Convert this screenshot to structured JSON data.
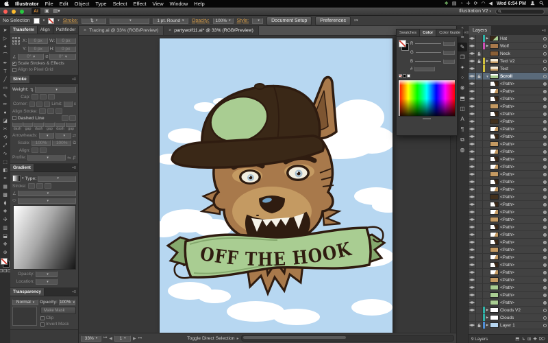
{
  "menubar": {
    "items": [
      "Illustrator",
      "File",
      "Edit",
      "Object",
      "Type",
      "Select",
      "Effect",
      "View",
      "Window",
      "Help"
    ],
    "status_icons": [
      {
        "n": "plugin-icon",
        "g": "❖",
        "c": "#7bc26a"
      },
      {
        "n": "display-icon",
        "g": "▤",
        "c": "#d8d8d8"
      },
      {
        "n": "clock-icon",
        "g": "◔",
        "c": "#d8d8d8"
      },
      {
        "n": "plus-icon",
        "g": "✛",
        "c": "#d8d8d8"
      },
      {
        "n": "sync-icon",
        "g": "⟳",
        "c": "#d8d8d8"
      },
      {
        "n": "wifi-icon",
        "g": "◠",
        "c": "#d8d8d8"
      },
      {
        "n": "volume-icon",
        "g": "◀",
        "c": "#d8d8d8"
      }
    ],
    "clock": "Wed 6:54 PM"
  },
  "titlebar": {
    "logo": "Ai",
    "workspace": "Illustration V2"
  },
  "controlbar": {
    "no_selection": "No Selection",
    "stroke_label": "Stroke:",
    "brush_value": "1 pt. Round",
    "opacity_label": "Opacity:",
    "opacity_value": "100%",
    "style_label": "Style:",
    "document_setup": "Document Setup",
    "preferences": "Preferences"
  },
  "tabs": [
    {
      "label": "Tracing.ai @ 33% (RGB/Preview)",
      "active": false
    },
    {
      "label": "partywolf11.ai* @ 33% (RGB/Preview)",
      "active": true
    }
  ],
  "toolbox": [
    {
      "n": "selection-tool",
      "g": "➤"
    },
    {
      "n": "direct-selection-tool",
      "g": "▷"
    },
    {
      "n": "magic-wand-tool",
      "g": "✦"
    },
    {
      "n": "lasso-tool",
      "g": "⌒"
    },
    {
      "n": "pen-tool",
      "g": "✒"
    },
    {
      "n": "type-tool",
      "g": "T"
    },
    {
      "n": "line-tool",
      "g": "╱"
    },
    {
      "n": "rectangle-tool",
      "g": "▭"
    },
    {
      "n": "paintbrush-tool",
      "g": "✎"
    },
    {
      "n": "pencil-tool",
      "g": "✏"
    },
    {
      "n": "blob-brush-tool",
      "g": "●"
    },
    {
      "n": "eraser-tool",
      "g": "◪"
    },
    {
      "n": "scissors-tool",
      "g": "✂"
    },
    {
      "n": "rotate-tool",
      "g": "⟲"
    },
    {
      "n": "scale-tool",
      "g": "⤢"
    },
    {
      "n": "width-tool",
      "g": "∿"
    },
    {
      "n": "free-transform-tool",
      "g": "⬚"
    },
    {
      "n": "shape-builder-tool",
      "g": "◧"
    },
    {
      "n": "perspective-grid-tool",
      "g": "⌗"
    },
    {
      "n": "mesh-tool",
      "g": "▦"
    },
    {
      "n": "gradient-tool",
      "g": "▩"
    },
    {
      "n": "eyedropper-tool",
      "g": "⧫"
    },
    {
      "n": "blend-tool",
      "g": "❖"
    },
    {
      "n": "symbol-sprayer-tool",
      "g": "✣"
    },
    {
      "n": "graph-tool",
      "g": "▥"
    },
    {
      "n": "artboard-tool",
      "g": "⬓"
    },
    {
      "n": "hand-tool",
      "g": "✥"
    },
    {
      "n": "zoom-tool",
      "g": "⊕"
    }
  ],
  "panels": {
    "transform": {
      "tabs": [
        "Transform",
        "Align",
        "Pathfinder"
      ],
      "x_label": "X:",
      "y_label": "Y:",
      "w_label": "W:",
      "h_label": "H:",
      "x_value": "0 px",
      "y_value": "0 px",
      "w_value": "0 px",
      "h_value": "0 px",
      "rotate_value": "0°",
      "shear_value": "0°",
      "scale_strokes": "Scale Strokes & Effects",
      "align_pixel": "Align to Pixel Grid"
    },
    "stroke": {
      "title": "Stroke",
      "weight_label": "Weight:",
      "cap_label": "Cap:",
      "corner_label": "Corner:",
      "limit_label": "Limit:",
      "limit_x": "x",
      "align_stroke_label": "Align Stroke:",
      "dashed_label": "Dashed Line",
      "dash_labels": [
        "dash",
        "gap",
        "dash",
        "gap",
        "dash",
        "gap"
      ],
      "arrowheads_label": "Arrowheads:",
      "scale_label": "Scale:",
      "scale_v1": "100%",
      "scale_v2": "100%",
      "align_label": "Align:",
      "profile_label": "Profile:"
    },
    "gradient": {
      "title": "Gradient",
      "type_label": "Type:",
      "stroke_label": "Stroke:",
      "opacity_label": "Opacity:",
      "location_label": "Location:"
    },
    "transparency": {
      "title": "Transparency",
      "blend_mode": "Normal",
      "opacity_label": "Opacity:",
      "opacity_value": "100%",
      "make_mask": "Make Mask",
      "clip": "Clip",
      "invert_mask": "Invert Mask"
    }
  },
  "color_panel": {
    "tabs": [
      "Swatches",
      "Color",
      "Color Guide"
    ],
    "channels": [
      "R",
      "G",
      "B"
    ],
    "hex_label": "#"
  },
  "right_dock": [
    {
      "n": "stroke-panel-icon",
      "g": "≡"
    },
    {
      "n": "brushes-panel-icon",
      "g": "✎",
      "active": true
    },
    {
      "n": "artboards-panel-icon",
      "g": "❐"
    },
    {
      "n": "graphic-styles-panel-icon",
      "g": "✦"
    },
    {
      "n": "pattern-panel-icon",
      "g": "⁘"
    },
    {
      "n": "appearance-panel-icon",
      "g": "❋"
    },
    {
      "n": "pathfinder-panel-icon",
      "g": "⬒"
    },
    {
      "n": "symbols-panel-icon",
      "g": "◫"
    },
    {
      "n": "character-panel-icon",
      "g": "A"
    },
    {
      "n": "paragraph-panel-icon",
      "g": "¶"
    },
    {
      "n": "links-panel-icon",
      "g": "⧉"
    },
    {
      "n": "navigator-panel-icon",
      "g": "◍"
    }
  ],
  "layers_panel": {
    "title": "Layers",
    "footer": "9 Layers",
    "footer_icons": [
      {
        "n": "clipping-mask-icon",
        "g": "⬒"
      },
      {
        "n": "new-sublayer-icon",
        "g": "↳"
      },
      {
        "n": "new-layer-icon",
        "g": "⊞"
      },
      {
        "n": "add-icon",
        "g": "✚"
      },
      {
        "n": "delete-layer-icon",
        "g": "⌦"
      }
    ],
    "rows": [
      {
        "label": "Hat",
        "kind": "layer",
        "eye": true,
        "lock": false,
        "bar": "#2fb3a8",
        "arrow": "collapsed",
        "thumb": "hat",
        "target": "ring",
        "selected": false
      },
      {
        "label": "Wolf",
        "kind": "layer",
        "eye": true,
        "lock": false,
        "bar": "#cb4fb5",
        "arrow": "collapsed",
        "thumb": "wolf",
        "target": "ring",
        "selected": false
      },
      {
        "label": "Neck",
        "kind": "layer",
        "eye": true,
        "lock": true,
        "bar": "",
        "arrow": "",
        "thumb": "neck",
        "target": "ring",
        "selected": false
      },
      {
        "label": "Text V2",
        "kind": "layer",
        "eye": true,
        "lock": true,
        "bar": "#d2c23c",
        "arrow": "collapsed",
        "thumb": "text",
        "target": "ring",
        "selected": false
      },
      {
        "label": "Text",
        "kind": "layer",
        "eye": true,
        "lock": false,
        "bar": "#d2c23c",
        "arrow": "",
        "thumb": "text",
        "target": "ring",
        "selected": false
      },
      {
        "label": "Scroll",
        "kind": "layer",
        "eye": true,
        "lock": true,
        "bar": "",
        "arrow": "expanded",
        "thumb": "scroll",
        "target": "ring",
        "selected": true
      },
      {
        "label": "<Path>",
        "kind": "path",
        "eye": true,
        "lock": false,
        "bar": "",
        "arrow": "",
        "thumb": "w2",
        "target": "disc",
        "selected": false
      },
      {
        "label": "<Path>",
        "kind": "path",
        "eye": true,
        "lock": false,
        "bar": "",
        "arrow": "",
        "thumb": "w1",
        "target": "disc",
        "selected": false
      },
      {
        "label": "<Path>",
        "kind": "path",
        "eye": true,
        "lock": false,
        "bar": "",
        "arrow": "",
        "thumb": "w2",
        "target": "disc",
        "selected": false
      },
      {
        "label": "<Path>",
        "kind": "path",
        "eye": true,
        "lock": false,
        "bar": "",
        "arrow": "",
        "thumb": "tan",
        "target": "disc",
        "selected": false
      },
      {
        "label": "<Path>",
        "kind": "path",
        "eye": true,
        "lock": false,
        "bar": "",
        "arrow": "",
        "thumb": "w2",
        "target": "disc",
        "selected": false
      },
      {
        "label": "<Path>",
        "kind": "path",
        "eye": true,
        "lock": false,
        "bar": "",
        "arrow": "",
        "thumb": "dark",
        "target": "disc",
        "selected": false
      },
      {
        "label": "<Path>",
        "kind": "path",
        "eye": true,
        "lock": false,
        "bar": "",
        "arrow": "",
        "thumb": "w1",
        "target": "disc",
        "selected": false
      },
      {
        "label": "<Path>",
        "kind": "path",
        "eye": true,
        "lock": false,
        "bar": "",
        "arrow": "",
        "thumb": "w2",
        "target": "disc",
        "selected": false
      },
      {
        "label": "<Path>",
        "kind": "path",
        "eye": true,
        "lock": false,
        "bar": "",
        "arrow": "",
        "thumb": "tan",
        "target": "disc",
        "selected": false
      },
      {
        "label": "<Path>",
        "kind": "path",
        "eye": true,
        "lock": false,
        "bar": "",
        "arrow": "",
        "thumb": "w1",
        "target": "disc",
        "selected": false
      },
      {
        "label": "<Path>",
        "kind": "path",
        "eye": true,
        "lock": false,
        "bar": "",
        "arrow": "",
        "thumb": "w2",
        "target": "disc",
        "selected": false
      },
      {
        "label": "<Path>",
        "kind": "path",
        "eye": true,
        "lock": false,
        "bar": "",
        "arrow": "",
        "thumb": "w1",
        "target": "disc",
        "selected": false
      },
      {
        "label": "<Path>",
        "kind": "path",
        "eye": true,
        "lock": false,
        "bar": "",
        "arrow": "",
        "thumb": "tan",
        "target": "disc",
        "selected": false
      },
      {
        "label": "<Path>",
        "kind": "path",
        "eye": true,
        "lock": false,
        "bar": "",
        "arrow": "",
        "thumb": "w2",
        "target": "disc",
        "selected": false
      },
      {
        "label": "<Path>",
        "kind": "path",
        "eye": true,
        "lock": false,
        "bar": "",
        "arrow": "",
        "thumb": "w1",
        "target": "disc",
        "selected": false
      },
      {
        "label": "<Path>",
        "kind": "path",
        "eye": true,
        "lock": false,
        "bar": "",
        "arrow": "",
        "thumb": "dark",
        "target": "disc",
        "selected": false
      },
      {
        "label": "<Path>",
        "kind": "path",
        "eye": true,
        "lock": false,
        "bar": "",
        "arrow": "",
        "thumb": "w2",
        "target": "disc",
        "selected": false
      },
      {
        "label": "<Path>",
        "kind": "path",
        "eye": true,
        "lock": false,
        "bar": "",
        "arrow": "",
        "thumb": "w1",
        "target": "disc",
        "selected": false
      },
      {
        "label": "<Path>",
        "kind": "path",
        "eye": true,
        "lock": false,
        "bar": "",
        "arrow": "",
        "thumb": "tan",
        "target": "disc",
        "selected": false
      },
      {
        "label": "<Path>",
        "kind": "path",
        "eye": true,
        "lock": false,
        "bar": "",
        "arrow": "",
        "thumb": "w2",
        "target": "disc",
        "selected": false
      },
      {
        "label": "<Path>",
        "kind": "path",
        "eye": true,
        "lock": false,
        "bar": "",
        "arrow": "",
        "thumb": "w1",
        "target": "disc",
        "selected": false
      },
      {
        "label": "<Path>",
        "kind": "path",
        "eye": true,
        "lock": false,
        "bar": "",
        "arrow": "",
        "thumb": "w2",
        "target": "disc",
        "selected": false
      },
      {
        "label": "<Path>",
        "kind": "path",
        "eye": true,
        "lock": false,
        "bar": "",
        "arrow": "",
        "thumb": "tan",
        "target": "disc",
        "selected": false
      },
      {
        "label": "<Path>",
        "kind": "path",
        "eye": true,
        "lock": false,
        "bar": "",
        "arrow": "",
        "thumb": "w1",
        "target": "disc",
        "selected": false
      },
      {
        "label": "<Path>",
        "kind": "path",
        "eye": true,
        "lock": false,
        "bar": "",
        "arrow": "",
        "thumb": "w2",
        "target": "disc",
        "selected": false
      },
      {
        "label": "<Path>",
        "kind": "path",
        "eye": true,
        "lock": false,
        "bar": "",
        "arrow": "",
        "thumb": "w1",
        "target": "disc",
        "selected": false
      },
      {
        "label": "<Path>",
        "kind": "path",
        "eye": true,
        "lock": false,
        "bar": "",
        "arrow": "",
        "thumb": "tan",
        "target": "disc",
        "selected": false
      },
      {
        "label": "<Path>",
        "kind": "path",
        "eye": true,
        "lock": false,
        "bar": "",
        "arrow": "",
        "thumb": "green",
        "target": "disc",
        "selected": false
      },
      {
        "label": "<Path>",
        "kind": "path",
        "eye": true,
        "lock": false,
        "bar": "",
        "arrow": "",
        "thumb": "green",
        "target": "disc",
        "selected": false
      },
      {
        "label": "<Path>",
        "kind": "path",
        "eye": true,
        "lock": false,
        "bar": "",
        "arrow": "",
        "thumb": "green",
        "target": "disc",
        "selected": false
      },
      {
        "label": "Clouds V2",
        "kind": "layer",
        "eye": true,
        "lock": false,
        "bar": "#2fb3a8",
        "arrow": "collapsed",
        "thumb": "white",
        "target": "ring",
        "selected": false
      },
      {
        "label": "Clouds",
        "kind": "layer",
        "eye": false,
        "lock": false,
        "bar": "#2fb3a8",
        "arrow": "collapsed",
        "thumb": "white",
        "target": "ring",
        "selected": false
      },
      {
        "label": "Layer 1",
        "kind": "layer",
        "eye": true,
        "lock": true,
        "bar": "#4f8fd9",
        "arrow": "collapsed",
        "thumb": "blue",
        "target": "ring",
        "selected": false
      }
    ]
  },
  "statusbar": {
    "zoom": "33%",
    "artboard": "1",
    "hint": "Toggle Direct Selection"
  },
  "artwork": {
    "banner_text": "OFF THE HOOK",
    "colors": {
      "sky": "#b7d7f1",
      "cloud": "#ffffff",
      "outline": "#2f1c10",
      "fur": "#a8794b",
      "fur_light": "#c49a62",
      "fur_dark": "#7d5531",
      "green": "#a9cd92",
      "green_dark": "#85a96e",
      "tongue": "#e0788f",
      "teeth": "#f5f2e8",
      "iris": "#a9bfcd",
      "nose_highlight": "#6f9fc4",
      "cap": "#3a2817"
    }
  }
}
